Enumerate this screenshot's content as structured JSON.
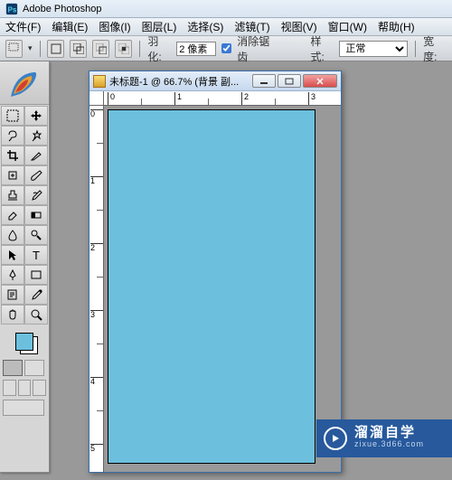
{
  "app": {
    "title": "Adobe Photoshop"
  },
  "menu": {
    "file": "文件(F)",
    "edit": "编辑(E)",
    "image": "图像(I)",
    "layer": "图层(L)",
    "select": "选择(S)",
    "filter": "滤镜(T)",
    "view": "视图(V)",
    "window": "窗口(W)",
    "help": "帮助(H)"
  },
  "options": {
    "feather_label": "羽化:",
    "feather_value": "2 像素",
    "antialias_label": "消除锯齿",
    "style_label": "样式:",
    "style_value": "正常",
    "width_label": "宽度:"
  },
  "doc": {
    "title": "未标题-1 @ 66.7% (背景 副...",
    "ruler_h": [
      "0",
      "1",
      "2",
      "3"
    ],
    "ruler_v": [
      "0",
      "1",
      "2",
      "3",
      "4",
      "5"
    ]
  },
  "colors": {
    "canvas": "#6cc0de",
    "foreground": "#6cc0de",
    "background": "#ffffff"
  },
  "watermark": {
    "brand": "溜溜自学",
    "url": "zixue.3d66.com"
  }
}
